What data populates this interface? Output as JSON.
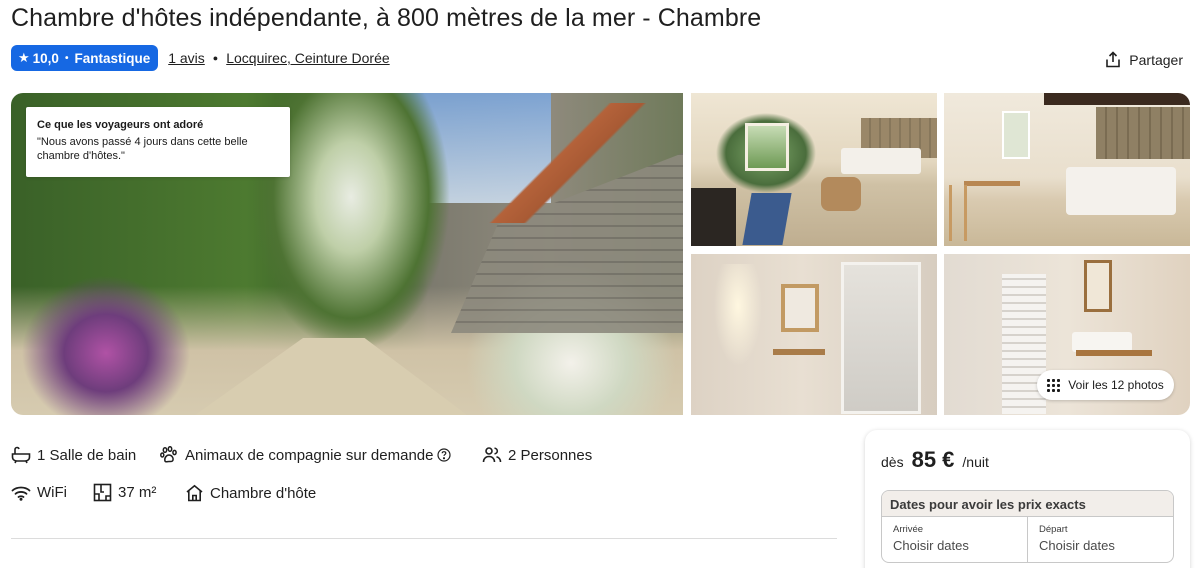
{
  "listing": {
    "title": "Chambre d'hôtes indépendante, à 800 mètres de la mer - Chambre",
    "rating": {
      "score": "10,0",
      "label": "Fantastique",
      "star_icon": "star-icon"
    },
    "reviews_link": "1 avis",
    "location_link": "Locquirec, Ceinture Dorée",
    "share_label": "Partager"
  },
  "gallery": {
    "highlight_title": "Ce que les voyageurs ont adoré",
    "highlight_quote": "\"Nous avons passé 4 jours dans cette belle chambre d'hôtes.\"",
    "view_photos_label": "Voir les 12 photos",
    "photos": [
      "garden-photo",
      "living-room-photo",
      "bedroom-photo",
      "bathroom-shower-photo",
      "bathroom-sink-photo"
    ]
  },
  "amenities": [
    {
      "icon": "bathtub-icon",
      "label": "1 Salle de bain"
    },
    {
      "icon": "paw-icon",
      "label": "Animaux de compagnie sur demande"
    },
    {
      "icon": "people-icon",
      "label": "2 Personnes"
    },
    {
      "icon": "wifi-icon",
      "label": "WiFi"
    },
    {
      "icon": "floor-plan-icon",
      "label": "37 m²"
    },
    {
      "icon": "house-icon",
      "label": "Chambre d'hôte"
    }
  ],
  "booking": {
    "price_prefix": "dès",
    "price": "85 €",
    "price_suffix": "/nuit",
    "dates_heading": "Dates pour avoir les prix exacts",
    "checkin_label": "Arrivée",
    "checkin_value": "Choisir dates",
    "checkout_label": "Départ",
    "checkout_value": "Choisir dates"
  },
  "colors": {
    "accent": "#1668e3",
    "text": "#1f1f1f",
    "dates_header_bg": "#f2eeea"
  }
}
